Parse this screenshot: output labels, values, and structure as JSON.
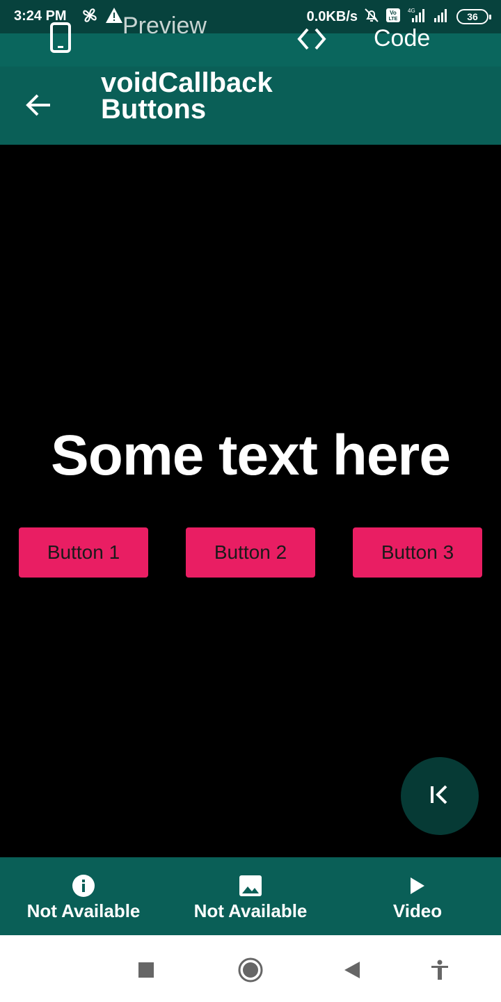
{
  "status_bar": {
    "time": "3:24 PM",
    "speed": "0.0KB/s",
    "battery": "36",
    "icons": [
      "fan-icon",
      "warning-icon",
      "mute-bell-icon",
      "volte-icon",
      "signal-4g-icon",
      "signal-icon",
      "battery-icon"
    ]
  },
  "mode_bar": {
    "preview_label": "Preview",
    "code_label": "Code",
    "icons": [
      "phone-icon",
      "code-icon"
    ]
  },
  "app_bar": {
    "title": "voidCallback Buttons",
    "back_icon": "arrow-left-icon"
  },
  "content": {
    "headline": "Some text here",
    "buttons": [
      "Button 1",
      "Button 2",
      "Button 3"
    ],
    "fab_icon": "first-page-icon"
  },
  "bottom_nav": {
    "items": [
      {
        "label": "Not Available",
        "icon": "info-icon"
      },
      {
        "label": "Not Available",
        "icon": "image-icon"
      },
      {
        "label": "Video",
        "icon": "play-icon"
      }
    ]
  },
  "system_nav": {
    "icons": [
      "recents-icon",
      "home-icon",
      "back-triangle-icon",
      "accessibility-icon"
    ]
  },
  "colors": {
    "status_bar": "#07423d",
    "mode_bar": "#0a665d",
    "app_bar": "#0a5f57",
    "button": "#e91e63",
    "fab": "#063a35",
    "background": "#000000"
  }
}
